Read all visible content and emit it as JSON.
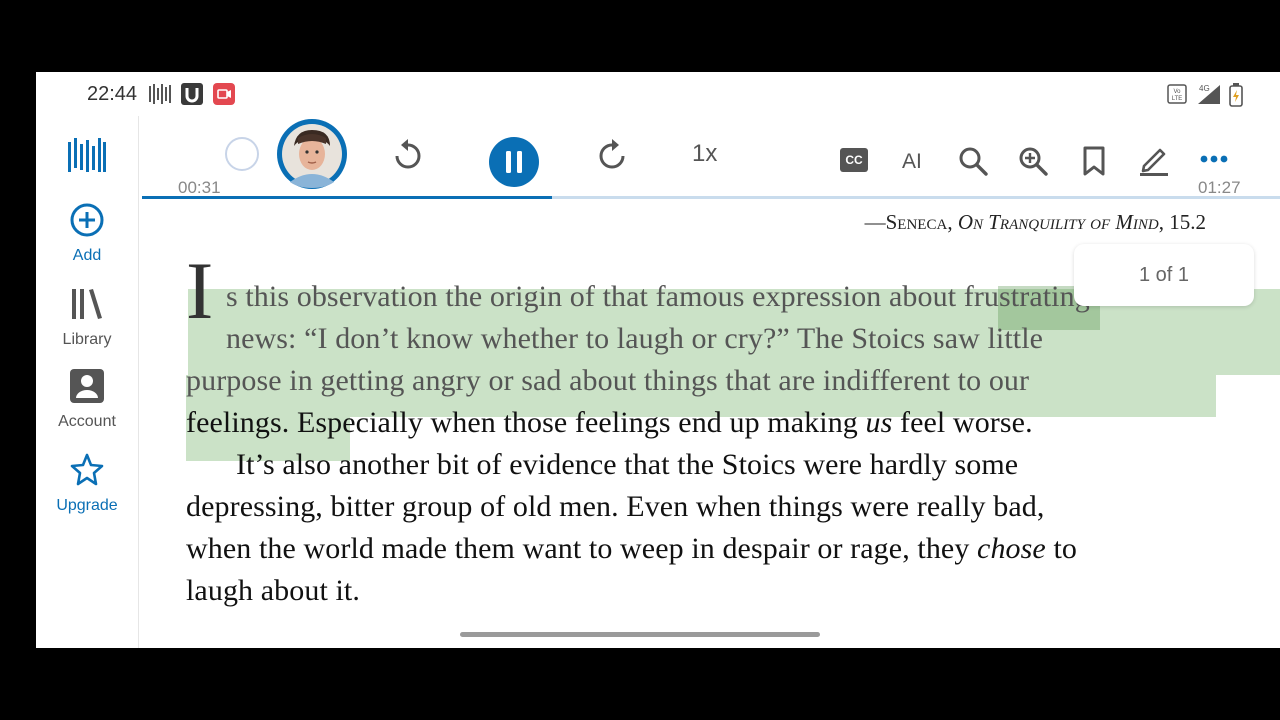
{
  "status_bar": {
    "time": "22:44",
    "left_icons": [
      "waveform-app-icon",
      "u-app-icon",
      "screen-record-icon"
    ],
    "right_icons": [
      "volte-icon",
      "signal-4g-icon",
      "battery-charging-icon"
    ],
    "network_label": "4G"
  },
  "sidebar": {
    "logo_icon": "app-logo-icon",
    "items": [
      {
        "label": "Add",
        "icon": "plus-circle-icon",
        "active": true
      },
      {
        "label": "Library",
        "icon": "library-icon",
        "active": false
      },
      {
        "label": "Account",
        "icon": "account-icon",
        "active": false
      },
      {
        "label": "Upgrade",
        "icon": "star-icon",
        "active": true
      }
    ]
  },
  "player": {
    "elapsed": "00:31",
    "remaining": "01:27",
    "progress": 0.36,
    "speed": "1x",
    "ai_label": "AI",
    "controls": [
      "rewind-icon",
      "pause-icon",
      "forward-icon"
    ],
    "tools": [
      "closed-captions-icon",
      "search-icon",
      "zoom-in-icon",
      "bookmark-icon",
      "highlight-pen-icon",
      "more-icon"
    ],
    "cc_label": "CC"
  },
  "reader": {
    "quote_dash": "—",
    "quote_author": "Seneca",
    "quote_work": "On Tranquility of Mind",
    "quote_ref": ", 15.2",
    "dropcap": "I",
    "lines": [
      "s this observation the origin of that famous expression about frustrating",
      "news: “I don’t know whether to laugh or cry?” The Stoics saw little",
      "purpose in getting angry or sad about things that are indifferent to our",
      "feelings. Especially when those feelings end up making us feel worse.",
      "It’s also another bit of evidence that the Stoics were hardly some",
      "depressing, bitter group of old men. Even when things were really bad,",
      "when the world made them want to weep in despair or rage, they chose to",
      "laugh about it."
    ],
    "line4_pre": "feelings. Especially when those feelings end up making ",
    "line4_em": "us",
    "line4_post": " feel worse.",
    "line7_pre": "when the world made them want to weep in despair or rage, they ",
    "line7_em": "chose",
    "line7_post": " to",
    "search_result": "1 of 1"
  },
  "colors": {
    "accent": "#0a6fb5",
    "highlight": "#a8cf9e"
  }
}
